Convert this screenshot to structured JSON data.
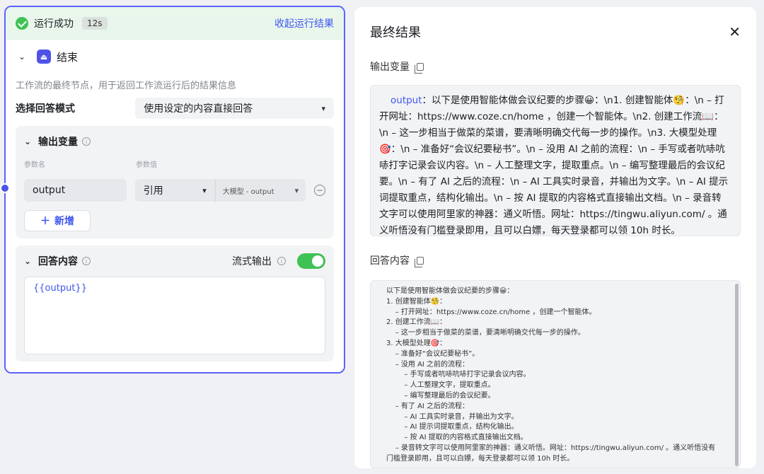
{
  "run": {
    "status": "运行成功",
    "duration": "12s",
    "collapse": "收起运行结果"
  },
  "node": {
    "title": "结束",
    "description": "工作流的最终节点，用于返回工作流运行后的结果信息",
    "mode_label": "选择回答模式",
    "mode_value": "使用设定的内容直接回答",
    "output_vars": {
      "title": "输出变量",
      "col_name": "参数名",
      "col_value": "参数值",
      "var_name": "output",
      "ref_type": "引用",
      "ref_value": "大模型 - output",
      "add_label": "新增"
    },
    "answer": {
      "title": "回答内容",
      "stream_label": "流式输出",
      "stream_on": true,
      "content": "{{output}}"
    }
  },
  "result": {
    "title": "最终结果",
    "output_label": "输出变量",
    "output_key": "output",
    "output_text": "：以下是使用智能体做会议纪要的步骤😀：\\n1. 创建智能体🧐：\\n – 打开网址：https://www.coze.cn/home ，创建一个智能体。\\n2. 创建工作流📖：\\n    – 这一步相当于做菜的菜谱，要清晰明确交代每一步的操作。\\n3. 大模型处理🎯：\\n    – 准备好“会议纪要秘书”。\\n    – 没用 AI 之前的流程：\\n    – 手写或者吭哧吭哧打字记录会议内容。\\n        – 人工整理文字，提取重点。\\n    – 编写整理最后的会议纪要。\\n    – 有了 AI 之后的流程：\\n        – AI 工具实时录音，并输出为文字。\\n        – AI 提示词提取重点，结构化输出。\\n        – 按 AI 提取的内容格式直接输出文档。\\n    – 录音转文字可以使用阿里家的神器：通义听悟。网址：https://tingwu.aliyun.com/ 。通义听悟没有门槛登录即用，且可以白嫖，每天登录都可以领 10h 时长。",
    "answer_label": "回答内容",
    "answer_lines": [
      "以下是使用智能体做会议纪要的步骤😀：",
      "1. 创建智能体🧐：",
      "    – 打开网址：https://www.coze.cn/home ，创建一个智能体。",
      "2. 创建工作流📖：",
      "    – 这一步相当于做菜的菜谱，要清晰明确交代每一步的操作。",
      "3. 大模型处理🎯：",
      "    – 准备好“会议纪要秘书”。",
      "    – 没用 AI 之前的流程：",
      "        – 手写或者吭哧吭哧打字记录会议内容。",
      "        – 人工整理文字，提取重点。",
      "        – 编写整理最后的会议纪要。",
      "    – 有了 AI 之后的流程：",
      "        – AI 工具实时录音，并输出为文字。",
      "        – AI 提示词提取重点，结构化输出。",
      "        – 按 AI 提取的内容格式直接输出文档。",
      "    – 录音转文字可以使用阿里家的神器：通义听悟。网址：https://tingwu.aliyun.com/ 。通义听悟没有",
      "门槛登录即用，且可以白嫖，每天登录都可以领 10h 时长。"
    ]
  },
  "colors": {
    "accent": "#3f56f0",
    "node_border": "#5c62ff",
    "success": "#3ec254"
  }
}
